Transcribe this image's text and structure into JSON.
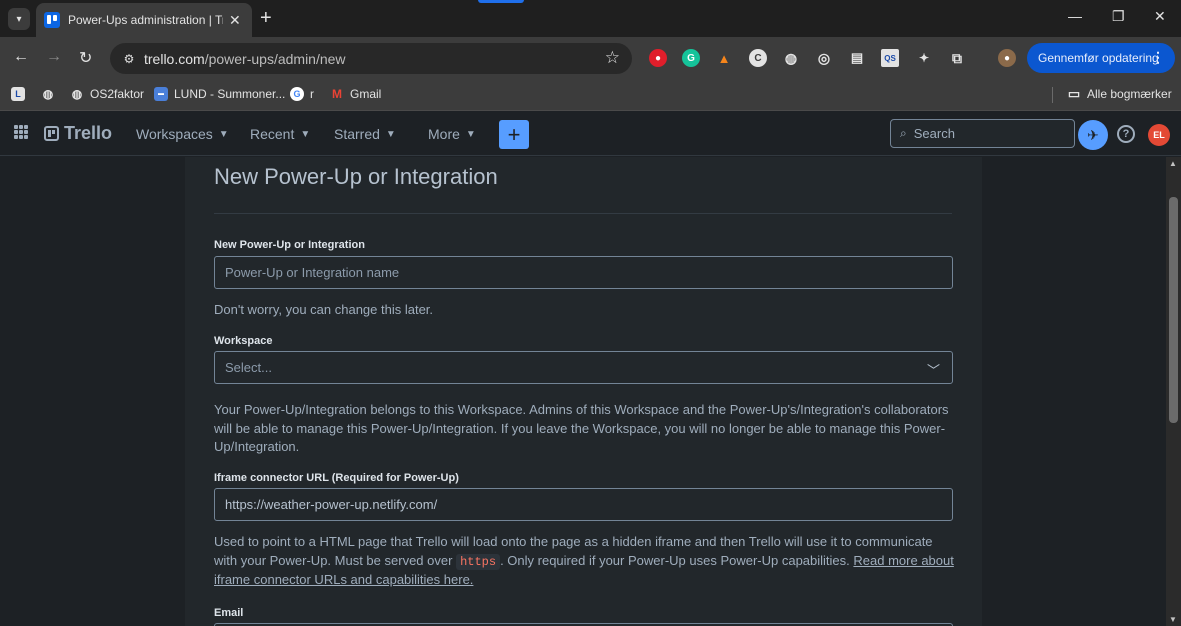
{
  "browser": {
    "tab_title": "Power-Ups administration | Trel",
    "url_host": "trello.com",
    "url_path": "/power-ups/admin/new",
    "update_button_label": "Gennemfør opdatering",
    "bookmarks": [
      "OS2faktor",
      "LUND - Summoner...",
      "r",
      "Gmail"
    ],
    "all_bookmarks_label": "Alle bogmærker"
  },
  "header": {
    "logo_text": "Trello",
    "menus": [
      "Workspaces",
      "Recent",
      "Starred",
      "More"
    ],
    "search_placeholder": "Search",
    "avatar_initials": "EL"
  },
  "form": {
    "title": "New Power-Up or Integration",
    "name_label": "New Power-Up or Integration",
    "name_placeholder": "Power-Up or Integration name",
    "name_help": "Don't worry, you can change this later.",
    "workspace_label": "Workspace",
    "workspace_value": "Select...",
    "workspace_help": "Your Power-Up/Integration belongs to this Workspace. Admins of this Workspace and the Power-Up's/Integration's collaborators will be able to manage this Power-Up/Integration. If you leave the Workspace, you will no longer be able to manage this Power-Up/Integration.",
    "iframe_label": "Iframe connector URL (Required for Power-Up)",
    "iframe_value": "https://weather-power-up.netlify.com/",
    "iframe_help_1": "Used to point to a HTML page that Trello will load onto the page as a hidden iframe and then Trello will use it to communicate with your Power-Up. Must be served over",
    "iframe_help_code": "https",
    "iframe_help_2": ". Only required if your Power-Up uses Power-Up capabilities.",
    "iframe_help_link": "Read more about iframe connector URLs and capabilities here.",
    "email_label": "Email"
  }
}
